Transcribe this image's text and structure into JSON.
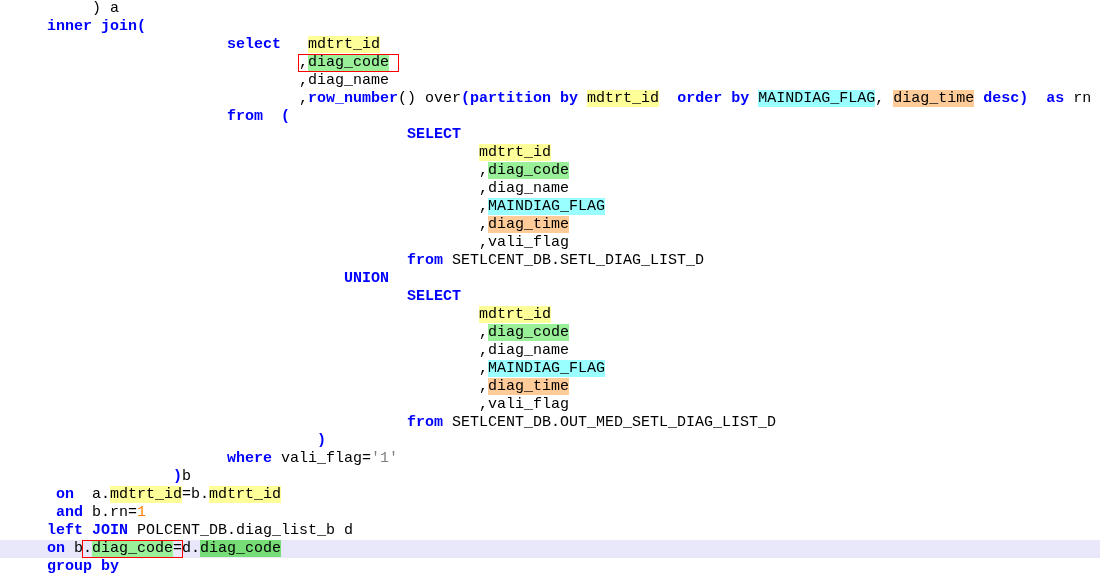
{
  "editor": {
    "lines": [
      {
        "selected": false,
        "tokens": [
          {
            "kind": "plain",
            "text": ") a"
          }
        ]
      },
      {
        "selected": false,
        "tokens": [
          {
            "kind": "keyword",
            "text": "inner join("
          }
        ]
      },
      {
        "selected": false,
        "tokens": [
          {
            "kind": "keyword",
            "text": "select   "
          },
          {
            "kind": "highlight",
            "text": "mdtrt_id",
            "color": "#ffff99"
          }
        ]
      },
      {
        "selected": false,
        "tokens": [
          {
            "kind": "box",
            "tokens": [
              {
                "text": ","
              },
              {
                "text": "diag_code",
                "color": "#99f099"
              }
            ]
          }
        ]
      },
      {
        "selected": false,
        "tokens": [
          {
            "kind": "plain",
            "text": ",diag_name"
          }
        ]
      },
      {
        "selected": false,
        "tokens": [
          {
            "kind": "plain",
            "text": ","
          },
          {
            "kind": "keyword",
            "text": "row_number"
          },
          {
            "kind": "plain",
            "text": "() over"
          },
          {
            "kind": "keyword",
            "text": "(partition by "
          },
          {
            "kind": "highlight",
            "text": "mdtrt_id",
            "color": "#ffff99"
          },
          {
            "kind": "keyword",
            "text": "  order by "
          },
          {
            "kind": "highlight",
            "text": "MAINDIAG_FLAG",
            "color": "#99ffff"
          },
          {
            "kind": "plain",
            "text": ", "
          },
          {
            "kind": "highlight",
            "text": "diag_time",
            "color": "#ffcc99"
          },
          {
            "kind": "keyword",
            "text": " desc)  as"
          },
          {
            "kind": "plain",
            "text": " rn"
          }
        ]
      },
      {
        "selected": false,
        "tokens": [
          {
            "kind": "keyword",
            "text": "from  ("
          }
        ]
      },
      {
        "selected": false,
        "tokens": [
          {
            "kind": "keyword",
            "text": "SELECT"
          }
        ]
      },
      {
        "selected": false,
        "tokens": [
          {
            "kind": "highlight",
            "text": "mdtrt_id",
            "color": "#ffff99"
          }
        ]
      },
      {
        "selected": false,
        "tokens": [
          {
            "kind": "plain",
            "text": ","
          },
          {
            "kind": "highlight",
            "text": "diag_code",
            "color": "#99f099"
          }
        ]
      },
      {
        "selected": false,
        "tokens": [
          {
            "kind": "plain",
            "text": ",diag_name"
          }
        ]
      },
      {
        "selected": false,
        "tokens": [
          {
            "kind": "plain",
            "text": ","
          },
          {
            "kind": "highlight",
            "text": "MAINDIAG_FLAG",
            "color": "#99ffff"
          }
        ]
      },
      {
        "selected": false,
        "tokens": [
          {
            "kind": "plain",
            "text": ","
          },
          {
            "kind": "highlight",
            "text": "diag_time",
            "color": "#ffcc99"
          }
        ]
      },
      {
        "selected": false,
        "tokens": [
          {
            "kind": "plain",
            "text": ",vali_flag"
          }
        ]
      },
      {
        "selected": false,
        "tokens": [
          {
            "kind": "keyword",
            "text": "from"
          },
          {
            "kind": "plain",
            "text": " SETLCENT_DB.SETL_DIAG_LIST_D"
          }
        ]
      },
      {
        "selected": false,
        "tokens": [
          {
            "kind": "keyword",
            "text": "UNION"
          }
        ]
      },
      {
        "selected": false,
        "tokens": [
          {
            "kind": "keyword",
            "text": "SELECT"
          }
        ]
      },
      {
        "selected": false,
        "tokens": [
          {
            "kind": "highlight",
            "text": "mdtrt_id",
            "color": "#ffff99"
          }
        ]
      },
      {
        "selected": false,
        "tokens": [
          {
            "kind": "plain",
            "text": ","
          },
          {
            "kind": "highlight",
            "text": "diag_code",
            "color": "#99f099"
          }
        ]
      },
      {
        "selected": false,
        "tokens": [
          {
            "kind": "plain",
            "text": ",diag_name"
          }
        ]
      },
      {
        "selected": false,
        "tokens": [
          {
            "kind": "plain",
            "text": ","
          },
          {
            "kind": "highlight",
            "text": "MAINDIAG_FLAG",
            "color": "#99ffff"
          }
        ]
      },
      {
        "selected": false,
        "tokens": [
          {
            "kind": "plain",
            "text": ","
          },
          {
            "kind": "highlight",
            "text": "diag_time",
            "color": "#ffcc99"
          }
        ]
      },
      {
        "selected": false,
        "tokens": [
          {
            "kind": "plain",
            "text": ",vali_flag"
          }
        ]
      },
      {
        "selected": false,
        "tokens": [
          {
            "kind": "keyword",
            "text": "from"
          },
          {
            "kind": "plain",
            "text": " SETLCENT_DB.OUT_MED_SETL_DIAG_LIST_D"
          }
        ]
      },
      {
        "selected": false,
        "tokens": [
          {
            "kind": "keyword",
            "text": ")"
          }
        ]
      },
      {
        "selected": false,
        "tokens": [
          {
            "kind": "keyword",
            "text": "where"
          },
          {
            "kind": "plain",
            "text": " vali_flag="
          },
          {
            "kind": "string",
            "text": "'1'"
          }
        ]
      },
      {
        "selected": false,
        "tokens": [
          {
            "kind": "keyword",
            "text": ")"
          },
          {
            "kind": "plain",
            "text": "b"
          }
        ]
      },
      {
        "selected": false,
        "tokens": [
          {
            "kind": "keyword",
            "text": "on"
          },
          {
            "kind": "plain",
            "text": "  a."
          },
          {
            "kind": "highlight",
            "text": "mdtrt_id",
            "color": "#ffff99"
          },
          {
            "kind": "plain",
            "text": "=b."
          },
          {
            "kind": "highlight",
            "text": "mdtrt_id",
            "color": "#ffff99"
          }
        ]
      },
      {
        "selected": false,
        "tokens": [
          {
            "kind": "keyword",
            "text": "and"
          },
          {
            "kind": "plain",
            "text": " b.rn="
          },
          {
            "kind": "number",
            "text": "1"
          }
        ]
      },
      {
        "selected": false,
        "tokens": [
          {
            "kind": "keyword",
            "text": "left JOIN"
          },
          {
            "kind": "plain",
            "text": " POLCENT_DB.diag_list_b d"
          }
        ]
      },
      {
        "selected": true,
        "tokens": [
          {
            "kind": "keyword",
            "text": "on"
          },
          {
            "kind": "plain",
            "text": " b"
          },
          {
            "kind": "box",
            "tokens": [
              {
                "text": "."
              },
              {
                "text": "diag_code",
                "color": "#99f099"
              },
              {
                "text": "="
              }
            ]
          },
          {
            "kind": "plain",
            "text": "d."
          },
          {
            "kind": "highlight",
            "text": "diag_code",
            "color": "#77dd77"
          }
        ]
      },
      {
        "selected": false,
        "tokens": [
          {
            "kind": "keyword",
            "text": "group by"
          }
        ]
      }
    ]
  }
}
